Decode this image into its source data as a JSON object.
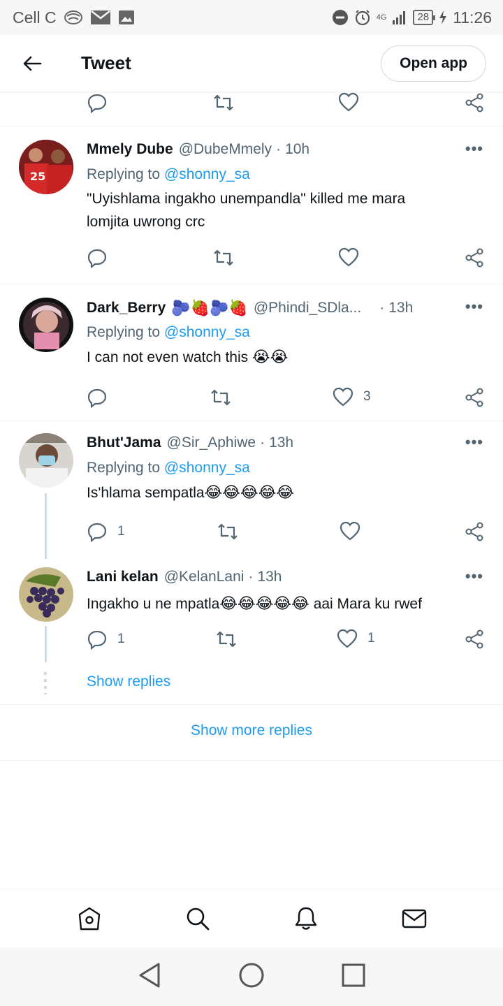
{
  "status_bar": {
    "carrier": "Cell C",
    "network": "4G",
    "battery": "28",
    "time": "11:26"
  },
  "header": {
    "title": "Tweet",
    "open_app_label": "Open app"
  },
  "top_actions": {
    "reply_count": "",
    "retweet_count": "",
    "like_count": ""
  },
  "tweets": [
    {
      "name": "Mmely Dube",
      "handle": "@DubeMmely",
      "time": "10h",
      "replying_prefix": "Replying to",
      "replying_to": "@shonny_sa",
      "text_line1": "\"Uyishlama ingakho unempandla\" killed me mara",
      "text_line2": "lomjita uwrong crc",
      "reply_count": "",
      "retweet_count": "",
      "like_count": ""
    },
    {
      "name": "Dark_Berry",
      "name_emoji": "🫐🍓🫐🍓",
      "handle": "@Phindi_SDla...",
      "time": "13h",
      "replying_prefix": "Replying to",
      "replying_to": "@shonny_sa",
      "text": "I can not even watch this",
      "text_emoji": "😭😭",
      "reply_count": "",
      "retweet_count": "",
      "like_count": "3"
    },
    {
      "name": "Bhut'Jama",
      "handle": "@Sir_Aphiwe",
      "time": "13h",
      "replying_prefix": "Replying to",
      "replying_to": "@shonny_sa",
      "text": "Is'hlama sempatla",
      "text_emoji": "😂😂😂😂😂",
      "reply_count": "1",
      "retweet_count": "",
      "like_count": ""
    },
    {
      "name": "Lani kelan",
      "handle": "@KelanLani",
      "time": "13h",
      "text": "Ingakho u ne mpatla",
      "text_emoji": "😂😂😂😂😂",
      "text_suffix": "aai Mara ku rwef",
      "reply_count": "1",
      "retweet_count": "",
      "like_count": "1"
    }
  ],
  "show_replies_label": "Show replies",
  "show_more_replies_label": "Show more replies",
  "bottom_nav": [
    "home-icon",
    "search-icon",
    "notifications-icon",
    "messages-icon"
  ],
  "colors": {
    "accent": "#1d9bf0",
    "text": "#0f1419",
    "muted": "#536471",
    "divider": "#eff3f4"
  }
}
